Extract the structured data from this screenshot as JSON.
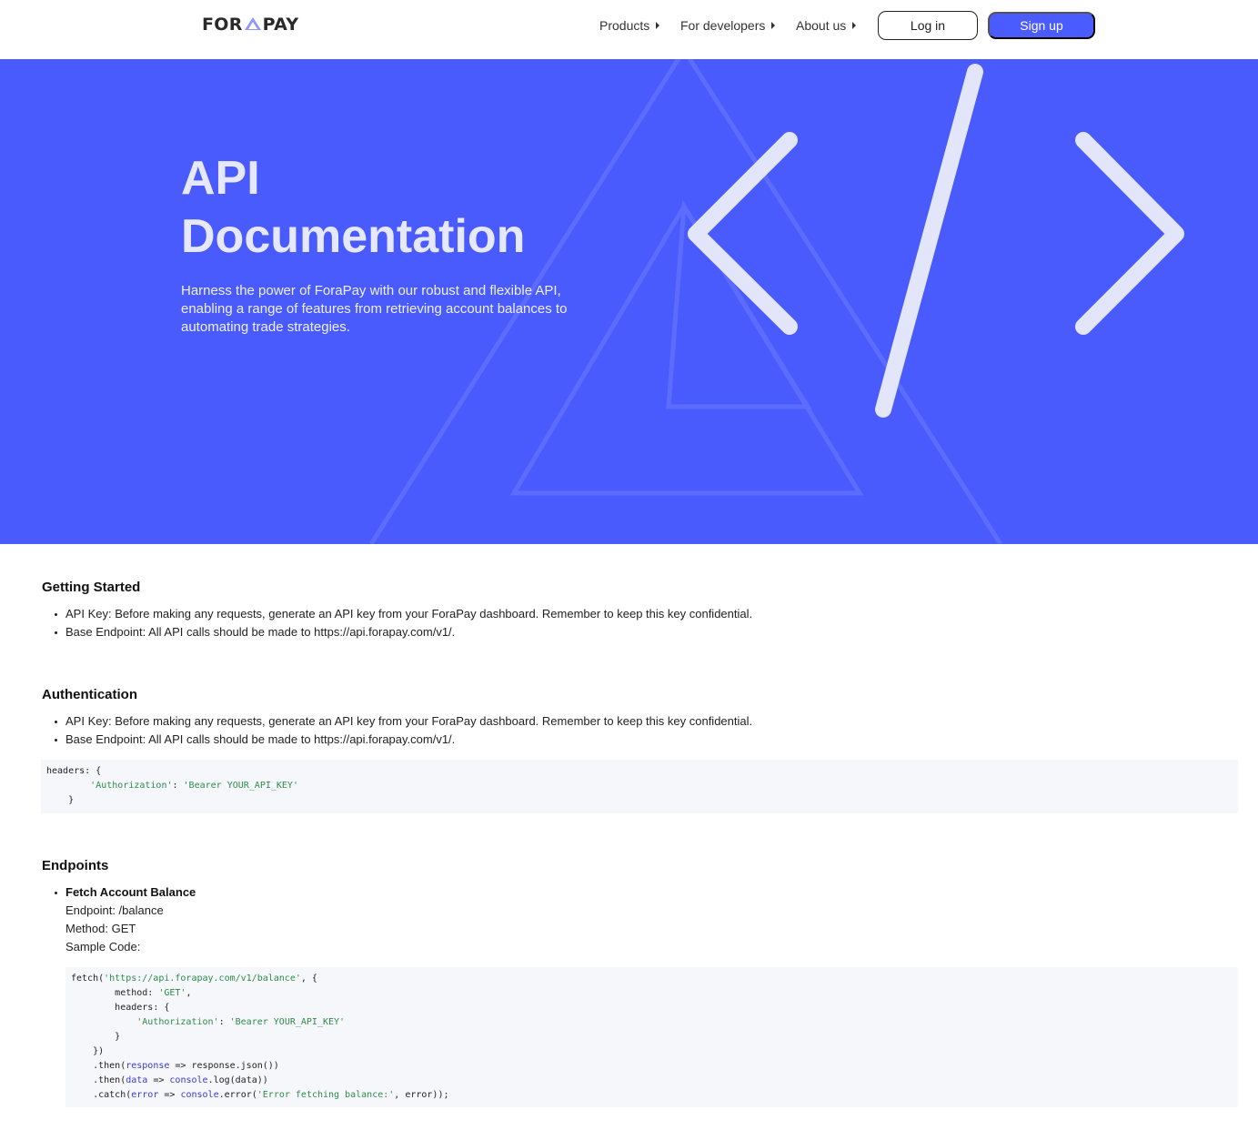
{
  "nav": {
    "logo_left": "FOR",
    "logo_right": "PAY",
    "menu": [
      {
        "label": "Products"
      },
      {
        "label": "For developers"
      },
      {
        "label": "About us"
      }
    ],
    "login_label": "Log in",
    "signup_label": "Sign up"
  },
  "hero": {
    "title_line1": "API",
    "title_line2": "Documentation",
    "description": "Harness the power of ForaPay with our robust and flexible API, enabling a range of features from retrieving account balances to automating trade strategies."
  },
  "getting_started": {
    "title": "Getting Started",
    "items": [
      "API Key: Before making any requests, generate an API key from your ForaPay dashboard. Remember to keep this key confidential.",
      "Base Endpoint: All API calls should be made to https://api.forapay.com/v1/."
    ]
  },
  "authentication": {
    "title": "Authentication",
    "items": [
      "API Key: Before making any requests, generate an API key from your ForaPay dashboard. Remember to keep this key confidential.",
      "Base Endpoint: All API calls should be made to https://api.forapay.com/v1/."
    ],
    "code": {
      "l1": "headers: {",
      "l2_key": "'Authorization'",
      "l2_sep": ": ",
      "l2_val": "'Bearer YOUR_API_KEY'",
      "l3": "}"
    }
  },
  "endpoints": {
    "title": "Endpoints",
    "fetch_balance": {
      "name": "Fetch Account Balance",
      "endpoint": "Endpoint: /balance",
      "method": "Method: GET",
      "sample_label": "Sample Code:"
    },
    "code": {
      "c1a": "fetch(",
      "c1b": "'https://api.forapay.com/v1/balance'",
      "c1c": ", {",
      "c2a": "method: ",
      "c2b": "'GET'",
      "c2c": ",",
      "c3": "headers: {",
      "c4a": "'Authorization'",
      "c4b": ": ",
      "c4c": "'Bearer YOUR_API_KEY'",
      "c5": "}",
      "c6": "})",
      "c7a": ".then(",
      "c7b": "response",
      "c7c": " => response.json())",
      "c8a": ".then(",
      "c8b": "data",
      "c8c": " => ",
      "c8d": "console",
      "c8e": ".log(data))",
      "c9a": ".catch(",
      "c9b": "error",
      "c9c": " => ",
      "c9d": "console",
      "c9e": ".error(",
      "c9f": "'Error fetching balance:'",
      "c9g": ", error));"
    }
  },
  "colors": {
    "brand": "#4b5cff",
    "hero_bg": "#4a5bfd",
    "code_bg": "#f6f7fb",
    "string": "#2e8b4a",
    "keyword": "#3a3acb"
  },
  "icons": [
    "logo-triangle-icon",
    "code-brackets-icon",
    "caret-right-icon"
  ]
}
